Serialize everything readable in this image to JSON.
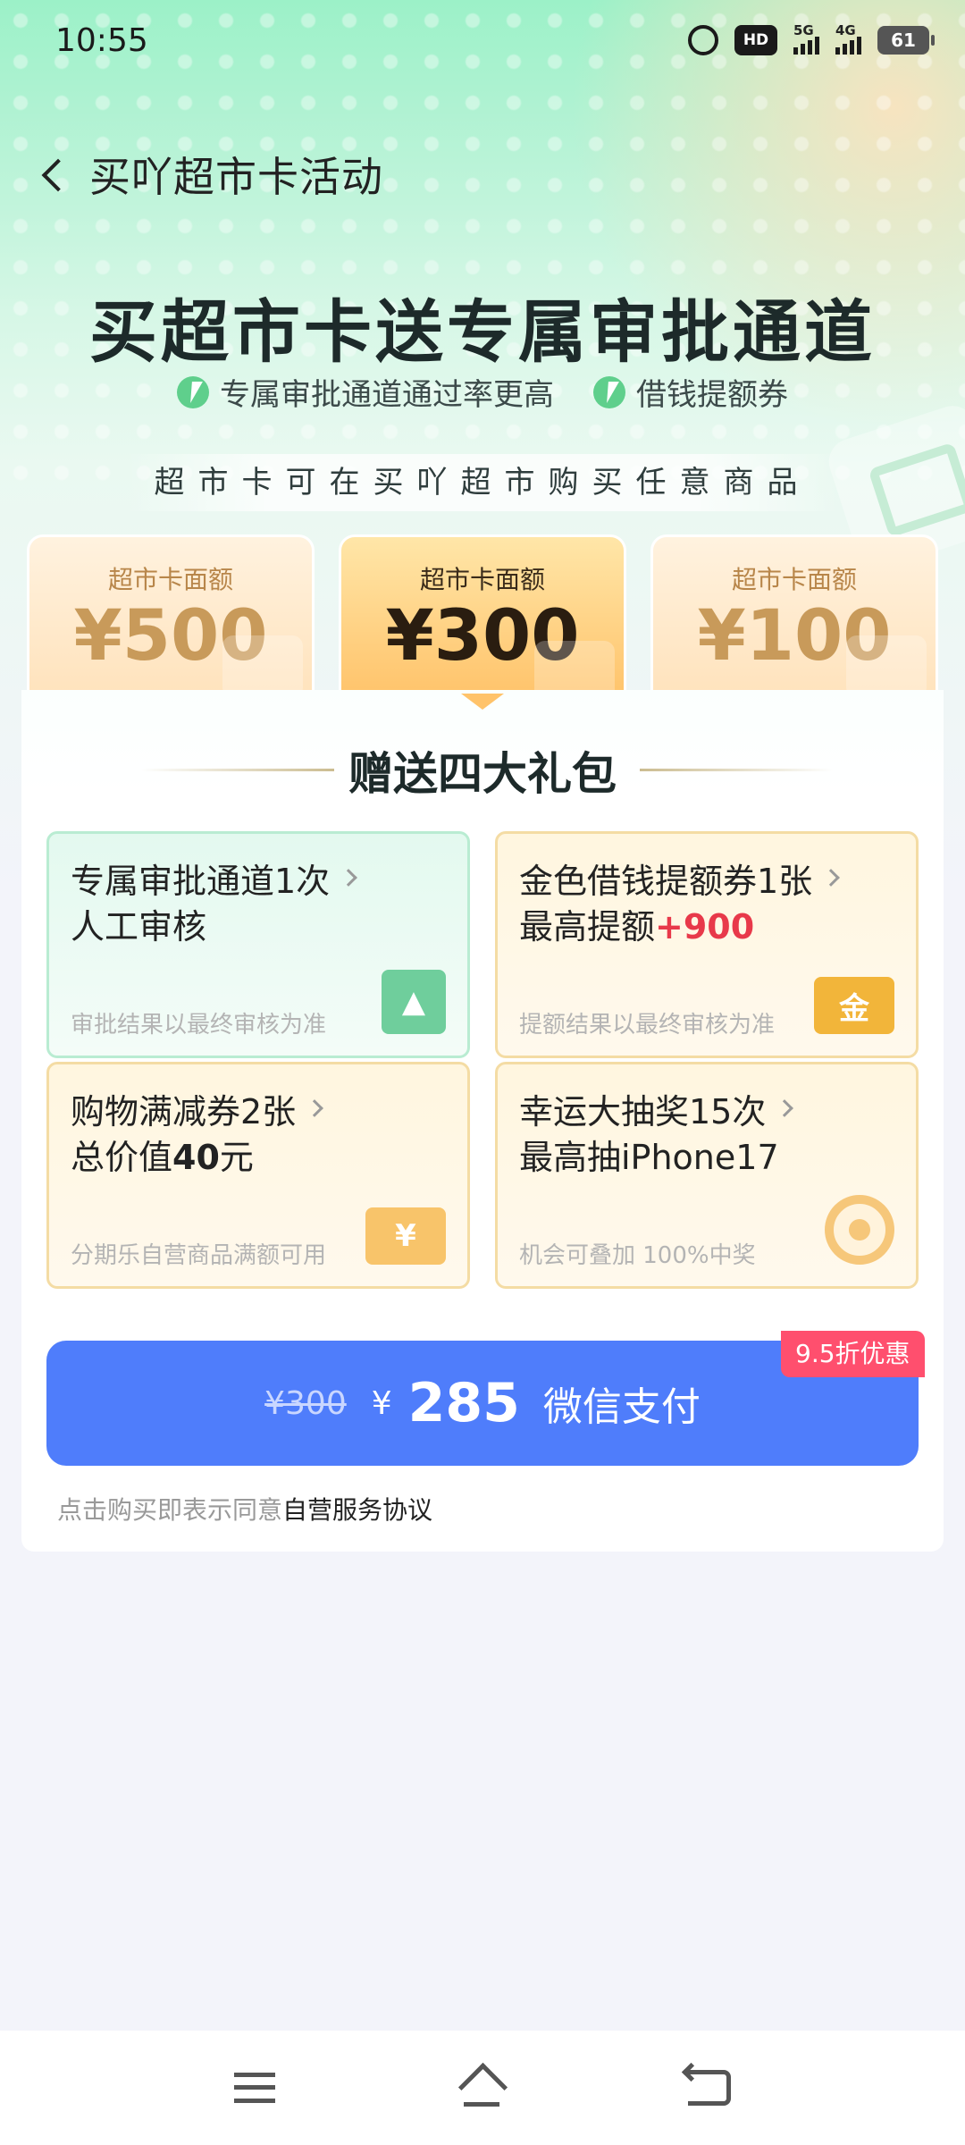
{
  "status_bar": {
    "time": "10:55",
    "icons": [
      "alarm-icon",
      "hd-icon",
      "signal-5g-icon",
      "signal-4g-icon",
      "battery-icon"
    ],
    "hd_label": "HD",
    "net1": "5G",
    "net2": "4G",
    "battery": "61"
  },
  "nav": {
    "title": "买吖超市卡活动",
    "back_icon": "back-icon"
  },
  "hero": {
    "headline": "买超市卡送专属审批通道",
    "features": [
      "专属审批通道通过率更高",
      "借钱提额券"
    ],
    "subline": "超市卡可在买吖超市购买任意商品"
  },
  "amounts": [
    {
      "label": "超市卡面额",
      "value": "¥500",
      "selected": false
    },
    {
      "label": "超市卡面额",
      "value": "¥300",
      "selected": true
    },
    {
      "label": "超市卡面额",
      "value": "¥100",
      "selected": false
    }
  ],
  "gifts": {
    "title": "赠送四大礼包",
    "items": [
      {
        "line1": "专属审批通道1次",
        "line2": "人工审核",
        "note": "审批结果以最终审核为准",
        "icon": "stamp-icon"
      },
      {
        "line1": "金色借钱提额券1张",
        "line2_prefix": "最高提额",
        "line2_highlight": "+900",
        "note": "提额结果以最终审核为准",
        "icon": "gold-coupon-icon",
        "icon_text": "金"
      },
      {
        "line1": "购物满减券2张",
        "line2_prefix": "总价值",
        "line2_bold": "40",
        "line2_suffix": "元",
        "note": "分期乐自营商品满额可用",
        "icon": "yen-coupon-icon",
        "icon_text": "¥"
      },
      {
        "line1": "幸运大抽奖15次",
        "line2": "最高抽iPhone17",
        "note": "机会可叠加 100%中奖",
        "icon": "prize-wheel-icon"
      }
    ]
  },
  "payment": {
    "original_price": "¥300",
    "currency_symbol": "¥",
    "price": "285",
    "label": "微信支付",
    "discount_badge": "9.5折优惠",
    "button_color": "#4f7dfb"
  },
  "agreement": {
    "prefix": "点击购买即表示同意",
    "link": "自营服务协议"
  },
  "bottom_nav": {
    "icons": [
      "menu-icon",
      "home-icon",
      "back-nav-icon"
    ]
  },
  "colors": {
    "accent_green": "#6fce9c",
    "highlight_red": "#e8394a",
    "badge_pink": "#ff4f6e",
    "gold": "#f2b53a"
  }
}
